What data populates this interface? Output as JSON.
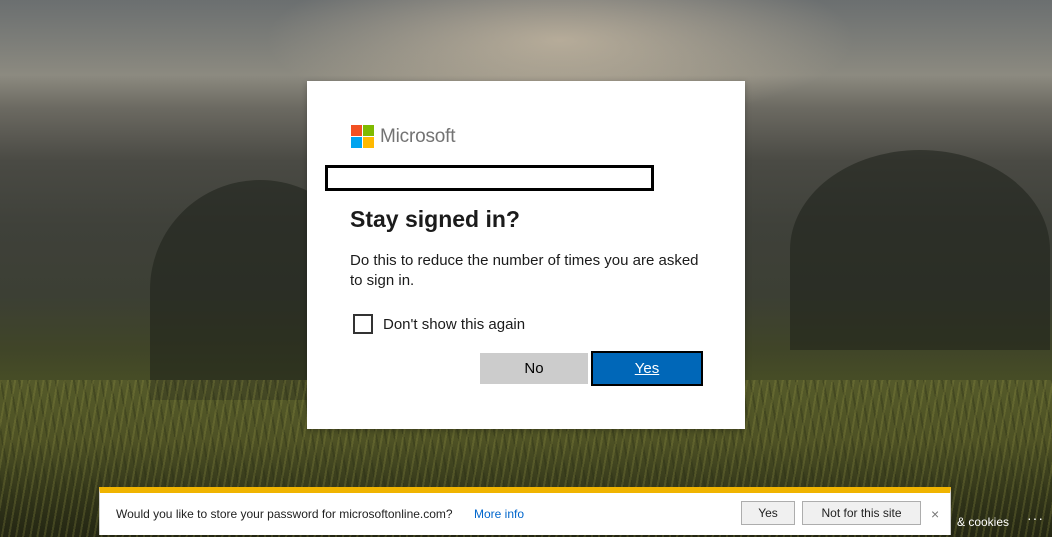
{
  "brand": {
    "name": "Microsoft",
    "logo_colors": [
      "#f25022",
      "#7fba00",
      "#00a4ef",
      "#ffb900"
    ]
  },
  "dialog": {
    "title": "Stay signed in?",
    "description": "Do this to reduce the number of times you are asked to sign in.",
    "checkbox_label": "Don't show this again",
    "checkbox_checked": false,
    "no_label": "No",
    "yes_label": "Yes"
  },
  "password_bar": {
    "message": "Would you like to store your password for microsoftonline.com?",
    "more_info": "More info",
    "yes_label": "Yes",
    "not_label": "Not for this site",
    "close_glyph": "×"
  },
  "footer": {
    "cookies_text": "& cookies",
    "more_glyph": "···"
  },
  "colors": {
    "accent": "#0067b8",
    "notification_bar": "#f0b400"
  }
}
